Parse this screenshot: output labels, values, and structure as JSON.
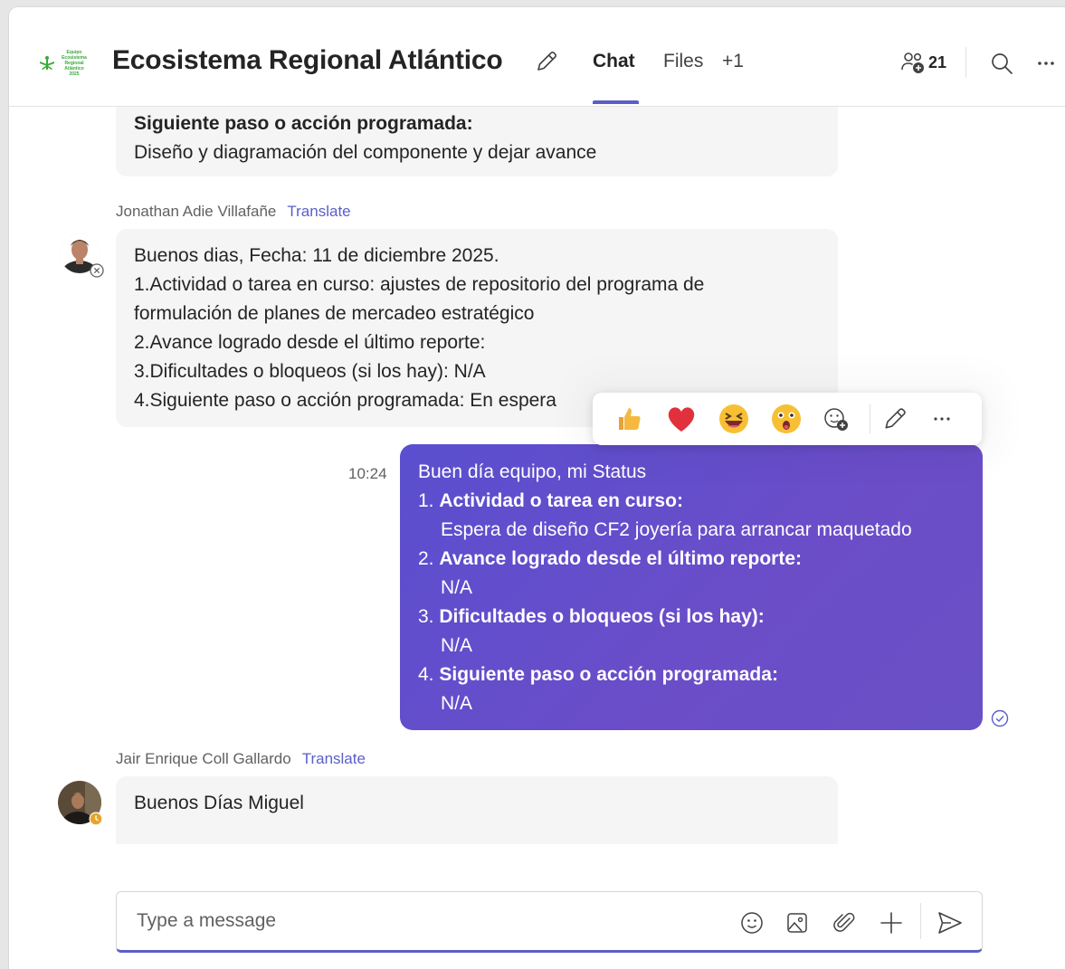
{
  "header": {
    "logo_text": [
      "Equipo",
      "Ecosistema",
      "Regional",
      "Atlántico",
      "2025"
    ],
    "title": "Ecosistema Regional Atlántico",
    "tabs": [
      {
        "label": "Chat",
        "active": true
      },
      {
        "label": "Files",
        "active": false
      },
      {
        "label": "+1",
        "active": false
      }
    ],
    "participants_count": "21"
  },
  "messages": [
    {
      "lines": [
        {
          "text": "Siguiente paso o acción programada:",
          "bold": true
        },
        {
          "text": "Diseño y diagramación del componente y dejar avance",
          "bold": false
        }
      ]
    },
    {
      "sender": "Jonathan Adie Villafañe",
      "translate": "Translate",
      "status": "offline",
      "lines": [
        "Buenos dias, Fecha: 11 de diciembre 2025.",
        "1.Actividad o tarea en curso: ajustes de repositorio del programa de",
        "formulación de planes de mercadeo estratégico",
        "2.Avance logrado desde el último reporte:",
        "3.Dificultades o bloqueos (si los hay): N/A",
        "4.Siguiente paso o acción programada: En espera"
      ]
    },
    {
      "own": true,
      "time": "10:24",
      "intro": "Buen día equipo, mi Status",
      "items": [
        {
          "num": "1.",
          "label": "Actividad o tarea en curso:",
          "value": "Espera de diseño CF2 joyería para arrancar maquetado"
        },
        {
          "num": "2.",
          "label": "Avance logrado desde el último reporte:",
          "value": "N/A"
        },
        {
          "num": "3.",
          "label": "Dificultades o bloqueos (si los hay):",
          "value": "N/A"
        },
        {
          "num": "4.",
          "label": "Siguiente paso o acción programada:",
          "value": "N/A"
        }
      ]
    },
    {
      "sender": "Jair Enrique Coll Gallardo",
      "translate": "Translate",
      "status": "away",
      "lines": [
        "Buenos Días  Miguel"
      ]
    }
  ],
  "reaction_bar": {
    "emojis": [
      "thumbs-up",
      "heart",
      "laughing",
      "surprised"
    ]
  },
  "composer": {
    "placeholder": "Type a message"
  },
  "colors": {
    "accent": "#5b5fc7",
    "own_bubble": "#5a4fcf",
    "other_bubble": "#f5f5f5"
  }
}
